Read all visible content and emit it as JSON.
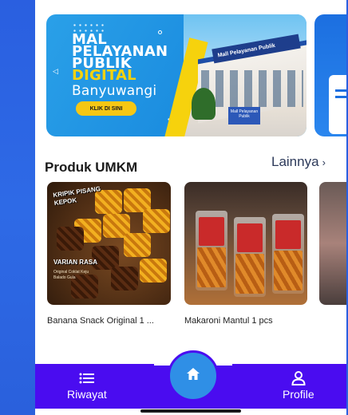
{
  "banners": [
    {
      "title_lines": [
        "MAL",
        "PELAYANAN",
        "PUBLIK",
        "DIGITAL",
        "Banyuwangi"
      ],
      "cta_label": "KLIK DI SINI",
      "building_sign": "Mall Pelayanan Publik",
      "small_sign": "Mall Pelayanan Publik"
    }
  ],
  "section": {
    "title": "Produk UMKM",
    "more_label": "Lainnya",
    "more_icon": "chevron-right-icon"
  },
  "products": [
    {
      "name": "Banana Snack Original 1 ...",
      "image_labels": [
        "KRIPIK PISANG KEPOK",
        "VARIAN RASA",
        "Original Coklat Keju Balado Gula"
      ]
    },
    {
      "name": "Makaroni Mantul 1 pcs"
    },
    {
      "name": ""
    }
  ],
  "bottom_nav": {
    "items": [
      {
        "label": "Riwayat",
        "icon": "list-icon"
      },
      {
        "label": "",
        "icon": "home-icon"
      },
      {
        "label": "Profile",
        "icon": "user-icon"
      }
    ],
    "colors": {
      "bar": "#4a0cf0",
      "home_button": "#2f8fe6"
    }
  },
  "colors": {
    "background": "#1f50d6",
    "banner_yellow": "#f6d20d"
  }
}
